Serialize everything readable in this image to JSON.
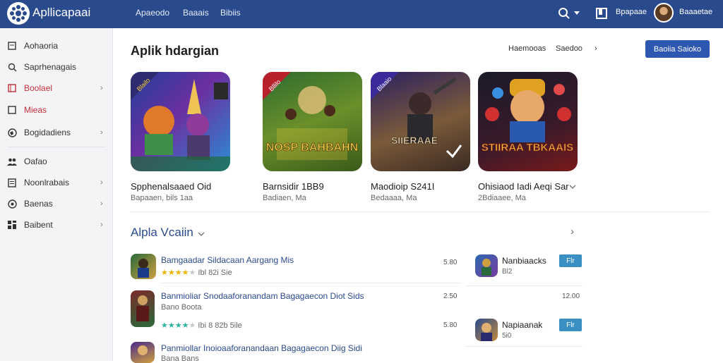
{
  "topbar": {
    "brand": "Apllicapaai",
    "nav": [
      "Apaeodo",
      "Baaais",
      "Bibiis"
    ],
    "user_label": "Bpapaae",
    "account_label": "Baaaetae"
  },
  "sidebar": {
    "items": [
      {
        "label": "Aohaoria",
        "icon": "square-icon",
        "chevron": ""
      },
      {
        "label": "Saprhenagais",
        "icon": "search-icon",
        "chevron": ""
      },
      {
        "label": "Boolael",
        "icon": "square-icon",
        "chevron": "›"
      },
      {
        "label": "Mieas",
        "icon": "square-icon",
        "chevron": ""
      },
      {
        "label": "Bogidadiens",
        "icon": "globe-icon",
        "chevron": "›"
      },
      {
        "label": "Oafao",
        "icon": "people-icon",
        "chevron": ""
      },
      {
        "label": "Noonlrabais",
        "icon": "document-icon",
        "chevron": "›"
      },
      {
        "label": "Baenas",
        "icon": "gauge-icon",
        "chevron": "›"
      },
      {
        "label": "Baibent",
        "icon": "grid-icon",
        "chevron": "›"
      }
    ]
  },
  "header": {
    "title": "Aplik hdargian",
    "link1": "Haemooas",
    "link2": "Saedoo",
    "link_chevron": "›",
    "button": "Baoiia Saioko"
  },
  "featured": [
    {
      "title": "Spphenalsaaed Oid",
      "sub": "Bapaaen, bils 1aa"
    },
    {
      "title": "Barnsidir 1BB9",
      "sub": "Badiaen, Ma"
    },
    {
      "title": "Maodioip S241I",
      "sub": "Bedaaaa, Ma"
    },
    {
      "title": "Ohisiaod Iadi Aeqi Sar",
      "sub": "2Bdiaaee, Ma"
    }
  ],
  "featured_art": [
    {
      "text": "",
      "badge": "Blailo"
    },
    {
      "text": "NOSP BAHBAHN",
      "badge": "Bllilo"
    },
    {
      "text": "SIIERAAE",
      "badge": "Blaaio"
    },
    {
      "text": "STIIRAA TBKAAIS",
      "badge": ""
    }
  ],
  "section": {
    "title": "Alpla Vcaiin",
    "chevron": "›"
  },
  "rows": [
    {
      "title": "Bamgaadar Sildacaan Aargang Mis",
      "sub": "",
      "rating": "Ibl 82i Sie",
      "meta": "5.80"
    },
    {
      "title": "Banmioliar Snodaaforanandam Bagagaecon Diot Sids",
      "sub": "Bano Boota",
      "rating": "Ibi 8 82b 5ile",
      "meta": "2.50"
    },
    {
      "title": "Panmiollar Inoioaaforanandaan Bagagaecon Diig Sidi",
      "sub": "Bana Bans",
      "rating": "",
      "meta": ""
    }
  ],
  "side_apps": [
    {
      "title": "Nanbiaacks",
      "sub": "Bl2",
      "button": "Flr",
      "meta": "12.00"
    },
    {
      "title": "Napiaanak",
      "sub": "5i0",
      "button": "Flr",
      "meta": ""
    }
  ],
  "colors": {
    "topbar": "#2a4a8e",
    "accent": "#2d57b0",
    "active": "#c0303b",
    "star": "#f0b400",
    "star_alt": "#2bb3a0"
  }
}
